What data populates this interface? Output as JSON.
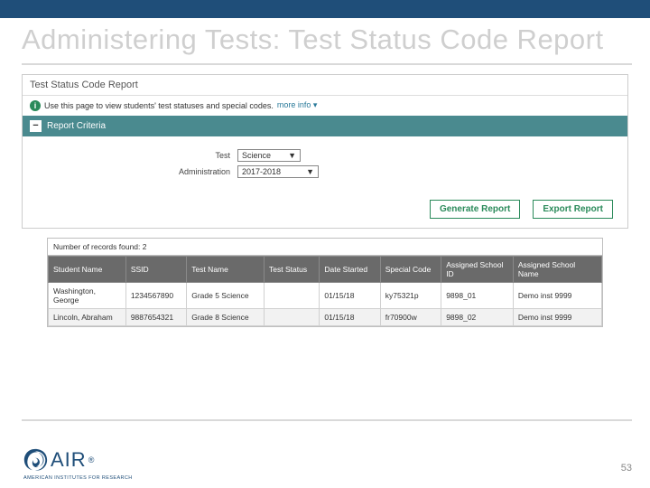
{
  "slide": {
    "title": "Administering Tests: Test Status Code Report",
    "page_number": "53"
  },
  "report": {
    "title": "Test Status Code Report",
    "info_text": "Use this page to view students' test statuses and special codes.",
    "more_info": "more info ▾",
    "criteria_header": "Report Criteria",
    "test_label": "Test",
    "test_value": "Science",
    "admin_label": "Administration",
    "admin_value": "2017-2018",
    "generate_btn": "Generate Report",
    "export_btn": "Export Report"
  },
  "table": {
    "records_label": "Number of records found: 2",
    "headers": [
      "Student Name",
      "SSID",
      "Test Name",
      "Test Status",
      "Date Started",
      "Special Code",
      "Assigned School ID",
      "Assigned School Name"
    ],
    "rows": [
      [
        "Washington, George",
        "1234567890",
        "Grade 5 Science",
        "",
        "01/15/18",
        "ky75321p",
        "9898_01",
        "Demo inst 9999"
      ],
      [
        "Lincoln, Abraham",
        "9887654321",
        "Grade 8 Science",
        "",
        "01/15/18",
        "fr70900w",
        "9898_02",
        "Demo inst 9999"
      ]
    ]
  },
  "logo": {
    "brand": "AIR",
    "tagline": "AMERICAN INSTITUTES FOR RESEARCH"
  }
}
